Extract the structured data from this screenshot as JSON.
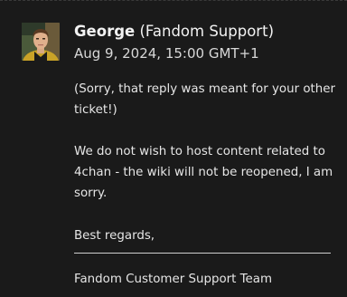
{
  "message": {
    "author_name": "George",
    "author_role": "(Fandom Support)",
    "timestamp": "Aug 9, 2024, 15:00 GMT+1",
    "paragraphs": [
      "(Sorry, that reply was meant for your other ticket!)",
      "We do not wish to host content related to 4chan - the wiki will not be reopened, I am sorry.",
      "Best regards,"
    ],
    "signature": "Fandom Customer Support Team",
    "avatar_icon": "user-avatar-icon"
  },
  "colors": {
    "background": "#1a1a1a",
    "text": "#e6e6e6"
  }
}
